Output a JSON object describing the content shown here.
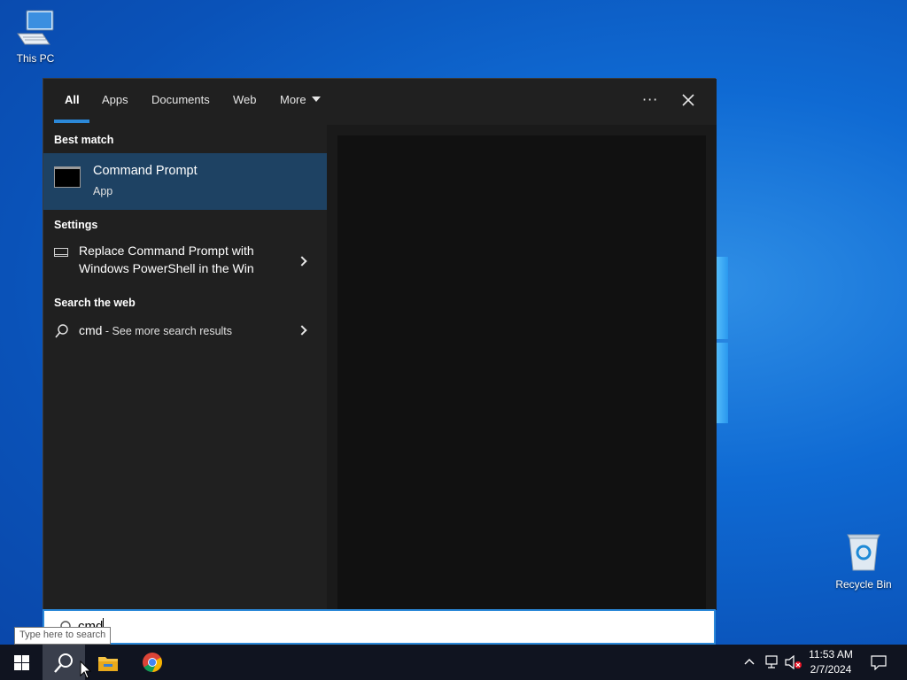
{
  "desktop": {
    "icons": [
      {
        "label": "This PC",
        "icon": "computer-icon"
      },
      {
        "label": "Recycle Bin",
        "icon": "recycle-bin-icon"
      }
    ]
  },
  "search_panel": {
    "tabs": [
      {
        "label": "All",
        "active": true
      },
      {
        "label": "Apps"
      },
      {
        "label": "Documents"
      },
      {
        "label": "Web"
      },
      {
        "label": "More"
      }
    ],
    "options_label": "···",
    "sections": {
      "best_match": "Best match",
      "settings": "Settings",
      "search_web": "Search the web"
    },
    "best_match_item": {
      "title": "Command Prompt",
      "subtitle": "App"
    },
    "setting_item": {
      "line1": "Replace Command Prompt with",
      "line2": "Windows PowerShell in the Win"
    },
    "web_item": {
      "query": "cmd",
      "more": " - See more search results"
    }
  },
  "search_box": {
    "value": "cmd",
    "tooltip": "Type here to search"
  },
  "taskbar": {
    "time": "11:53 AM",
    "date": "2/7/2024"
  },
  "colors": {
    "accent": "#2b88d8",
    "selection": "#1e4263",
    "panel": "#202020",
    "taskbar": "#101420"
  }
}
